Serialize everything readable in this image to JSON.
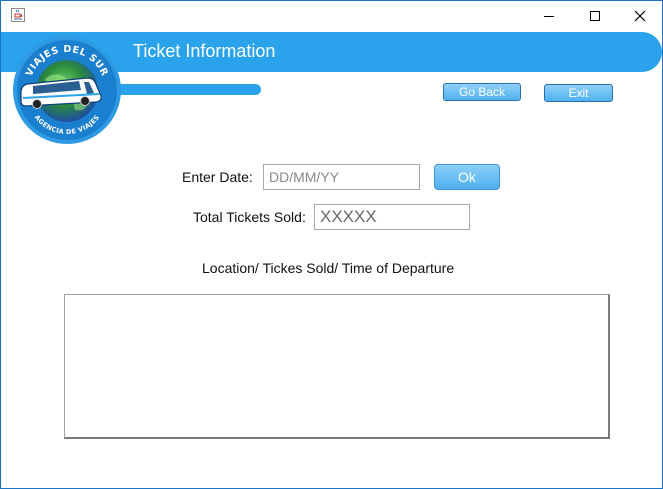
{
  "window": {
    "icon": "java-cup-icon",
    "controls": {
      "minimize": "minimize-icon",
      "maximize": "maximize-icon",
      "close": "close-icon"
    }
  },
  "header": {
    "title": "Ticket Information",
    "logo_top_text": "VIAJES DEL SUR",
    "logo_bottom_text": "AGENCIA DE VIAJES",
    "accent_color": "#2aa3ec"
  },
  "nav": {
    "go_back_label": "Go Back",
    "exit_label": "Exit"
  },
  "form": {
    "date_label": "Enter Date:",
    "date_placeholder": "DD/MM/YY",
    "ok_label": "Ok",
    "total_label": "Total Tickets Sold:",
    "total_value": "XXXXX",
    "list_caption": "Location/ Tickes Sold/ Time of Departure",
    "list_value": ""
  }
}
